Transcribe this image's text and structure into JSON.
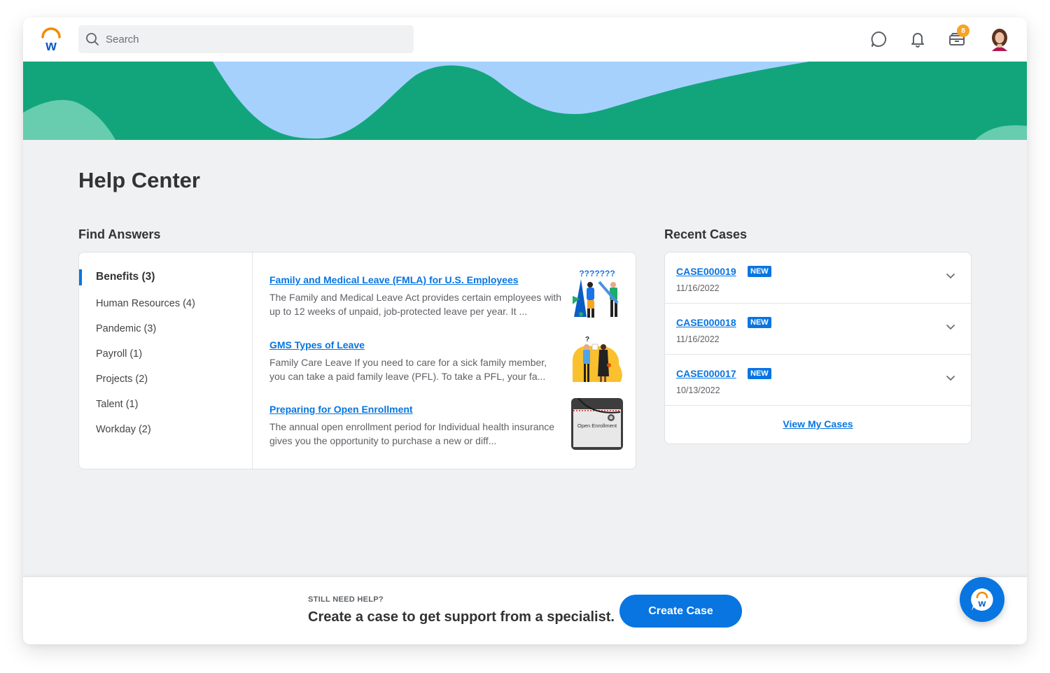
{
  "header": {
    "search_placeholder": "Search",
    "icons": [
      "chat-icon",
      "bell-icon",
      "inbox-icon",
      "avatar"
    ],
    "inbox_badge": "8"
  },
  "colors": {
    "accent": "#0875e1",
    "banner_green": "#12a57c",
    "banner_sky": "#a6d1fd",
    "banner_mint": "#68ccae",
    "badge_orange": "#f7a325",
    "logo_orange": "#f38b00"
  },
  "page": {
    "title": "Help Center"
  },
  "find_answers": {
    "title": "Find Answers",
    "categories": [
      {
        "label": "Benefits (3)",
        "active": true
      },
      {
        "label": "Human Resources (4)"
      },
      {
        "label": "Pandemic (3)"
      },
      {
        "label": "Payroll (1)"
      },
      {
        "label": "Projects (2)"
      },
      {
        "label": "Talent (1)"
      },
      {
        "label": "Workday (2)"
      }
    ],
    "articles": [
      {
        "title": "Family and Medical Leave (FMLA) for U.S. Employees",
        "snippet": "The Family and Medical Leave Act provides certain employees with up to 12 weeks of unpaid, job-protected leave per year. It ...",
        "thumbnail": "people-questions-illustration"
      },
      {
        "title": "GMS Types of Leave",
        "snippet": "Family Care Leave If you need to care for a sick family member, you can take a paid family leave (PFL). To take a PFL, your fa...",
        "thumbnail": "two-people-talking-illustration"
      },
      {
        "title": "Preparing for Open Enrollment",
        "snippet": "The annual open enrollment period for Individual health insurance gives you the opportunity to purchase a new or diff...",
        "thumbnail": "open-enrollment-photo",
        "thumbnail_text": "Open Enrollment"
      }
    ]
  },
  "recent_cases": {
    "title": "Recent Cases",
    "cases": [
      {
        "id": "CASE000019",
        "status": "NEW",
        "date": "11/16/2022"
      },
      {
        "id": "CASE000018",
        "status": "NEW",
        "date": "11/16/2022"
      },
      {
        "id": "CASE000017",
        "status": "NEW",
        "date": "10/13/2022"
      }
    ],
    "view_all_label": "View My Cases"
  },
  "footer": {
    "eyebrow": "STILL NEED HELP?",
    "message": "Create a case to get support from a specialist.",
    "button_label": "Create Case"
  }
}
